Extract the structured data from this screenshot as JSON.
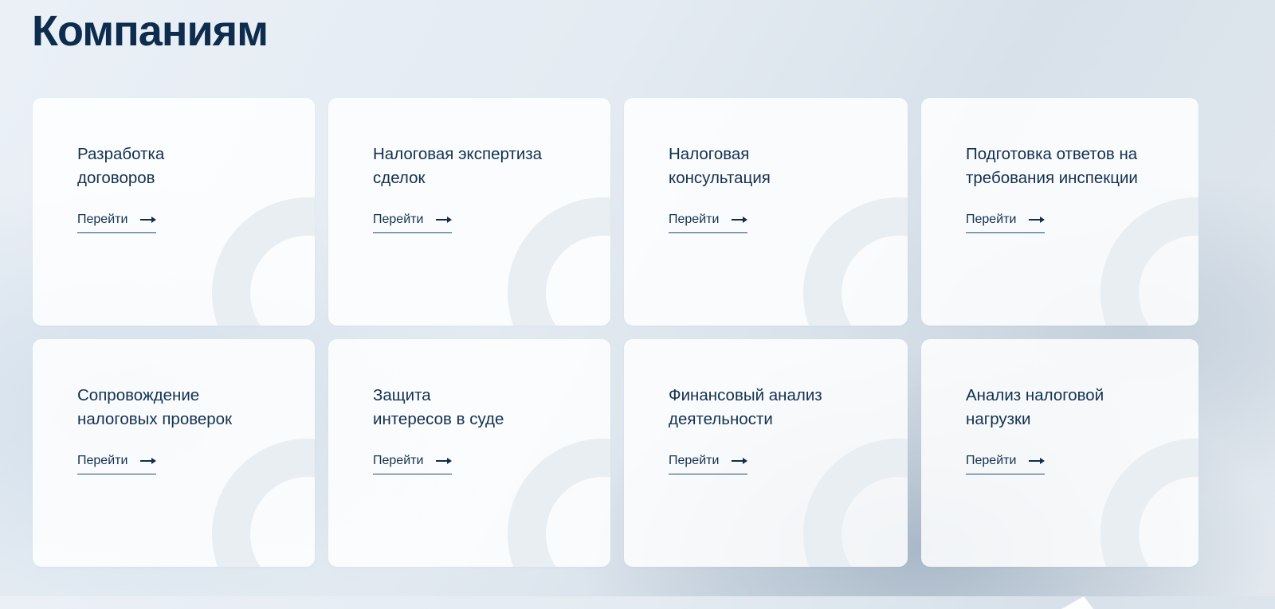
{
  "page": {
    "title": "Компаниям"
  },
  "services": [
    {
      "title_line1": "Разработка",
      "title_line2": "договоров",
      "link_label": "Перейти",
      "link_icon": "arrow-right-icon"
    },
    {
      "title_line1": "Налоговая экспертиза",
      "title_line2": "сделок",
      "link_label": "Перейти",
      "link_icon": "arrow-right-icon"
    },
    {
      "title_line1": "Налоговая",
      "title_line2": "консультация",
      "link_label": "Перейти",
      "link_icon": "arrow-right-icon"
    },
    {
      "title_line1": "Подготовка ответов на",
      "title_line2": "требования инспекции",
      "link_label": "Перейти",
      "link_icon": "arrow-right-icon"
    },
    {
      "title_line1": "Сопровождение",
      "title_line2": "налоговых проверок",
      "link_label": "Перейти",
      "link_icon": "arrow-right-icon"
    },
    {
      "title_line1": "Защита",
      "title_line2": "интересов в суде",
      "link_label": "Перейти",
      "link_icon": "arrow-right-icon"
    },
    {
      "title_line1": "Финансовый анализ",
      "title_line2": "деятельности",
      "link_label": "Перейти",
      "link_icon": "arrow-right-icon"
    },
    {
      "title_line1": "Анализ налоговой",
      "title_line2": "нагрузки",
      "link_label": "Перейти",
      "link_icon": "arrow-right-icon"
    }
  ],
  "colors": {
    "heading": "#0d2c4e",
    "text": "#13314f",
    "link_underline": "#1d4a73",
    "card_background": "#ffffff",
    "decor_arc": "#e9eef2"
  }
}
